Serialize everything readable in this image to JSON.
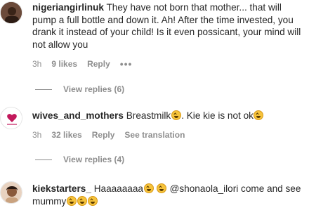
{
  "comments": [
    {
      "username": "nigeriangirlinuk",
      "text": "They have not born that mother... that will pump a full bottle and down it. Ah! After the time invested, you drank it instead of your child! Is it even possicant, your mind will not allow you",
      "time": "3h",
      "likes": "9 likes",
      "reply": "Reply",
      "more": "•••",
      "view_replies": "View replies (6)"
    },
    {
      "username": "wives_and_mothers",
      "text_a": "Breastmilk",
      "text_b": ". Kie kie is not ok",
      "time": "3h",
      "likes": "32 likes",
      "reply": "Reply",
      "see_translation": "See translation",
      "view_replies": "View replies (4)"
    },
    {
      "username": "kiekstarters_",
      "text_a": "Haaaaaaaa",
      "mention": "@shonaola_ilori",
      "text_b": " come and see",
      "text_c": "mummy"
    }
  ]
}
